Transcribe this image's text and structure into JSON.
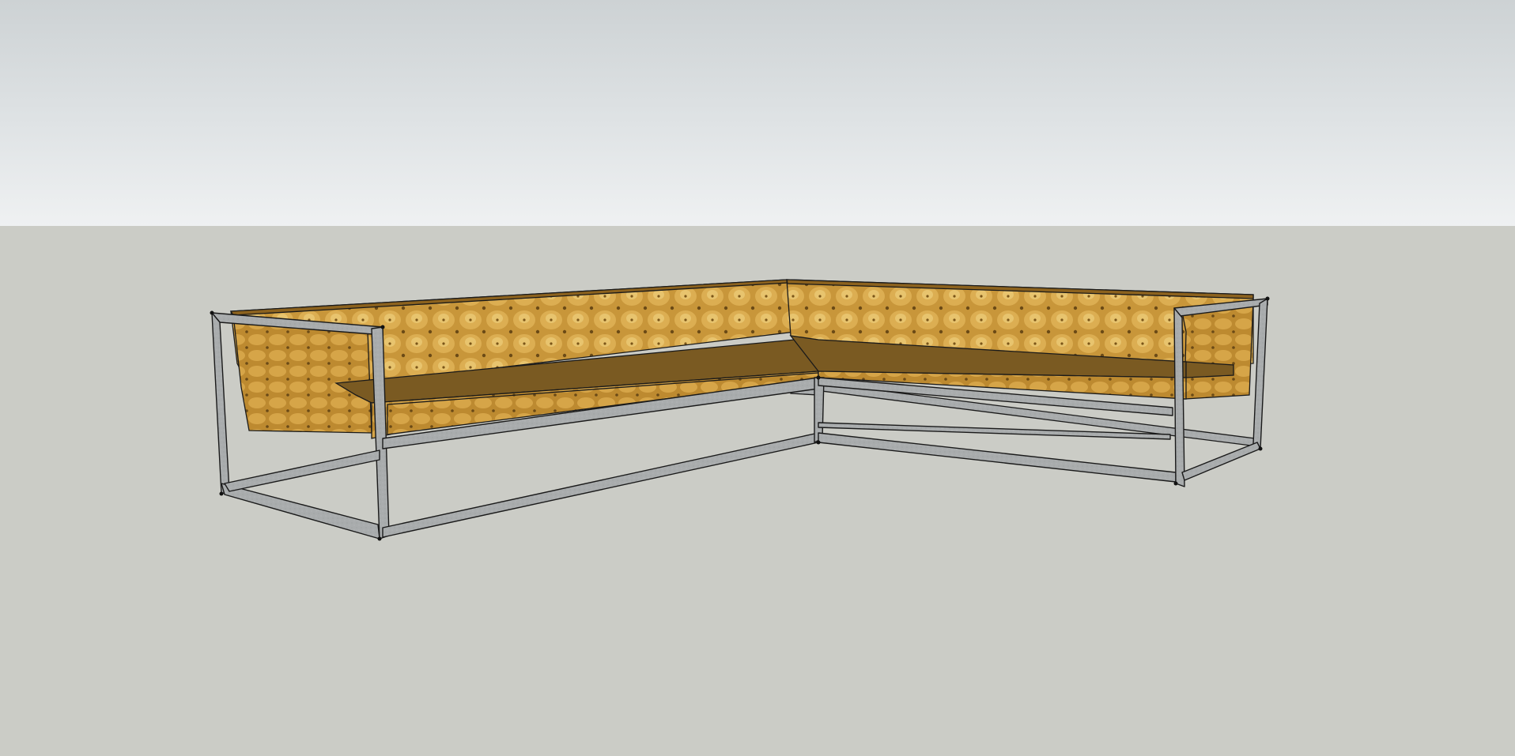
{
  "scene": {
    "model": "sectional-sofa",
    "colors": {
      "sky_top": "#cdd2d4",
      "sky_bottom": "#eff1f2",
      "ground": "#cbccc6",
      "leather": "#c8963a",
      "leather_dark": "#8c621e",
      "seat_top": "#7a5a22",
      "frame": "#a9acad",
      "frame_dark": "#7e8183",
      "edge": "#1a1a1a"
    }
  }
}
